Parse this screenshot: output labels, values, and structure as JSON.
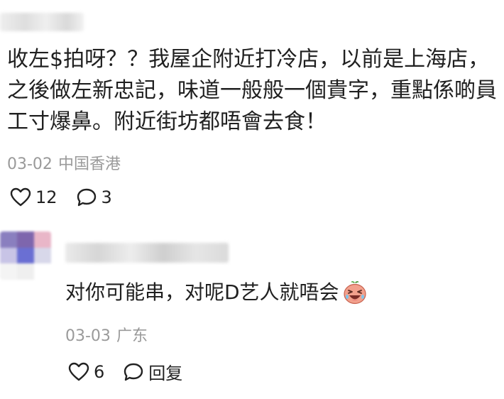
{
  "comments": [
    {
      "body": "收左$拍呀？？我屋企附近打冷店，以前是上海店，之後做左新忠記，味道一般般一個貴字，重點係啲員工寸爆鼻。附近街坊都唔會去食！",
      "date": "03-02",
      "location": "中国香港",
      "likes": "12",
      "replies": "3"
    },
    {
      "body": "对你可能串，对呢D艺人就唔会",
      "emoji": "crying-laughing-face",
      "date": "03-03",
      "location": "广东",
      "likes": "6",
      "reply_label": "回复"
    }
  ],
  "icons": {
    "like": "heart-outline-icon",
    "reply": "speech-bubble-icon"
  },
  "colors": {
    "text": "#202020",
    "meta": "#9a9a9a",
    "avatar": [
      "#8a7fbf",
      "#7e66ad",
      "#e9b6c8",
      "#c8c4e6",
      "#6a6fd3",
      "#d8d8ea",
      "#f4f4f4",
      "#efefef",
      "#ffffff"
    ]
  }
}
